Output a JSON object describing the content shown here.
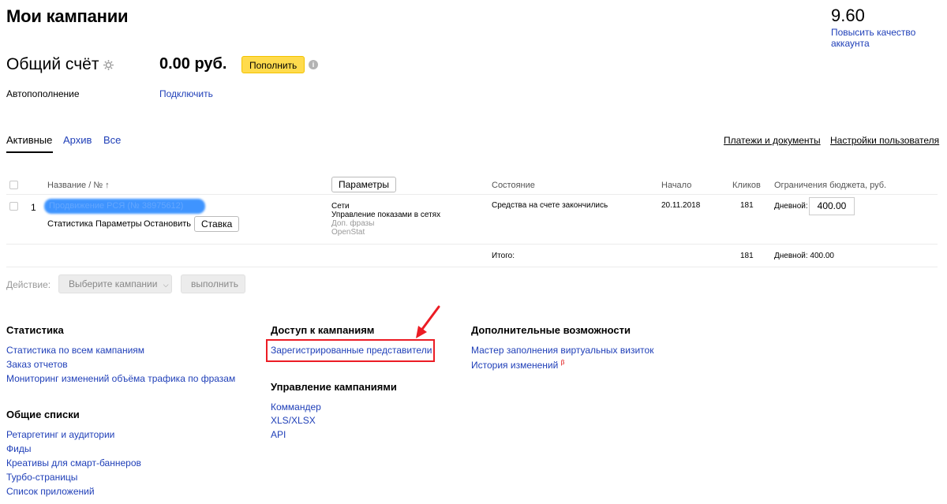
{
  "header": {
    "title": "Мои кампании",
    "quality_score": "9.60",
    "quality_link": "Повысить качество аккаунта"
  },
  "account": {
    "title": "Общий счёт",
    "balance": "0.00 руб.",
    "topup_label": "Пополнить",
    "autopay_label": "Автопополнение",
    "autopay_link": "Подключить"
  },
  "tabs": {
    "items": [
      "Активные",
      "Архив",
      "Все"
    ],
    "active": "Активные",
    "payments_link": "Платежи и документы",
    "user_settings_link": "Настройки пользователя"
  },
  "table": {
    "columns": {
      "name": "Название / № ↑",
      "params_button": "Параметры",
      "status": "Состояние",
      "start": "Начало",
      "clicks": "Кликов",
      "budget": "Ограничения бюджета, руб."
    },
    "rows": [
      {
        "index": "1",
        "campaign_name": "Продвижение РСЯ (№ 38975612)",
        "actions": [
          "Статистика",
          "Параметры",
          "Остановить"
        ],
        "bid_button": "Ставка",
        "targeting": [
          "Сети",
          "Управление показами в сетях"
        ],
        "targeting_extra": [
          "Доп. фразы",
          "OpenStat"
        ],
        "status": "Средства на счете закончились",
        "start": "20.11.2018",
        "clicks": "181",
        "budget_label": "Дневной:",
        "budget_value": "400.00"
      }
    ],
    "total": {
      "label": "Итого:",
      "clicks": "181",
      "budget": "Дневной: 400.00"
    }
  },
  "actions_bar": {
    "label": "Действие:",
    "select_placeholder": "Выберите кампании",
    "execute_label": "выполнить"
  },
  "footer": {
    "statistics": {
      "title": "Статистика",
      "links": [
        "Статистика по всем кампаниям",
        "Заказ отчетов",
        "Мониторинг изменений объёма трафика по фразам"
      ]
    },
    "common_lists": {
      "title": "Общие списки",
      "links": [
        "Ретаргетинг и аудитории",
        "Фиды",
        "Креативы для смарт-баннеров",
        "Турбо-страницы",
        "Список приложений"
      ]
    },
    "access": {
      "title": "Доступ к кампаниям",
      "links": [
        "Зарегистрированные представители"
      ]
    },
    "management": {
      "title": "Управление кампаниями",
      "links": [
        "Коммандер",
        "XLS/XLSX",
        "API"
      ]
    },
    "extra": {
      "title": "Дополнительные возможности",
      "links": [
        "Мастер заполнения виртуальных визиток",
        "История изменений"
      ],
      "new_badge": "β"
    }
  },
  "colors": {
    "link": "#1f3fb8",
    "accent_yellow": "#ffdb4d",
    "highlight_red": "#ec1c24",
    "redaction_blue": "#2f8cff"
  }
}
